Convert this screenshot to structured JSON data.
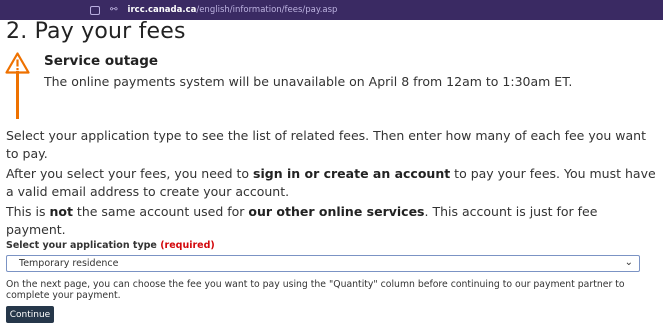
{
  "browser": {
    "url_host": "ircc.canada.ca",
    "url_path": "/english/information/fees/pay.asp",
    "icons": [
      "tab-icon",
      "site-settings-icon"
    ]
  },
  "page": {
    "title": "2. Pay your fees"
  },
  "alert": {
    "icon": "warning-icon",
    "accent_color": "#ee7100",
    "heading": "Service outage",
    "body": "The online payments system will be unavailable on April 8 from 12am to 1:30am ET."
  },
  "intro": {
    "p1": "Select your application type to see the list of related fees. Then enter how many of each fee you want to pay.",
    "p2_a": "After you select your fees, you need to ",
    "p2_strong": "sign in or create an account",
    "p2_b": " to pay your fees. You must have a valid email address to create your account.",
    "p3_a": "This is ",
    "p3_strong1": "not",
    "p3_b": " the same account used for ",
    "p3_strong2": "our other online services",
    "p3_c": ". This account is just for fee payment."
  },
  "form": {
    "label": "Select your application type",
    "required": "(required)",
    "required_color": "#d3080c",
    "selected_value": "Temporary residence",
    "note": "On the next page, you can choose the fee you want to pay using the \"Quantity\" column before continuing to our payment partner to complete your payment.",
    "continue_label": "Continue",
    "button_color": "#26374a"
  }
}
